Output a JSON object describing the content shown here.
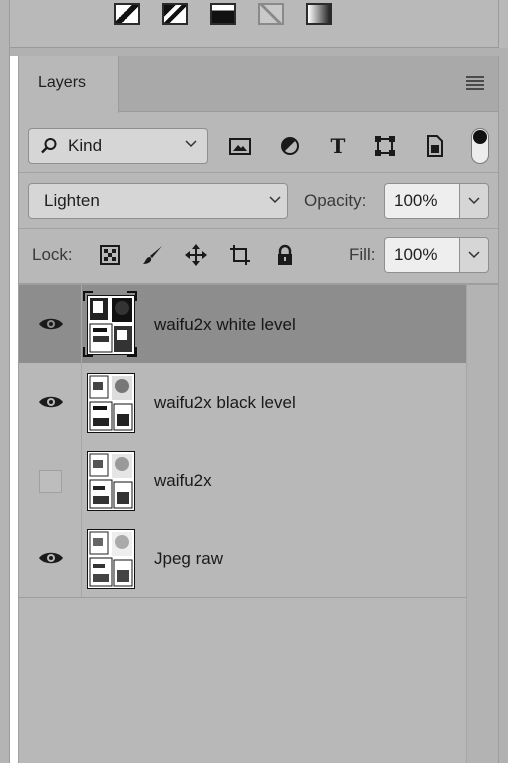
{
  "panel": {
    "tab_label": "Layers"
  },
  "filter": {
    "kind_label": "Kind",
    "icons": [
      "image-filter-icon",
      "adjustment-filter-icon",
      "type-filter-icon",
      "shape-filter-icon",
      "smart-object-filter-icon"
    ],
    "type_glyph": "T"
  },
  "blend": {
    "mode": "Lighten",
    "opacity_label": "Opacity:",
    "opacity_value": "100%"
  },
  "lock": {
    "label": "Lock:",
    "fill_label": "Fill:",
    "fill_value": "100%"
  },
  "layers": [
    {
      "name": "waifu2x white level",
      "visible": true,
      "selected": true
    },
    {
      "name": "waifu2x black level",
      "visible": true,
      "selected": false
    },
    {
      "name": "waifu2x",
      "visible": false,
      "selected": false
    },
    {
      "name": "Jpeg raw",
      "visible": true,
      "selected": false
    }
  ],
  "colors": {
    "panel_bg": "#b8b8b8",
    "selected_row": "#8d8d8d",
    "tab_bar": "#a9a9a9"
  }
}
